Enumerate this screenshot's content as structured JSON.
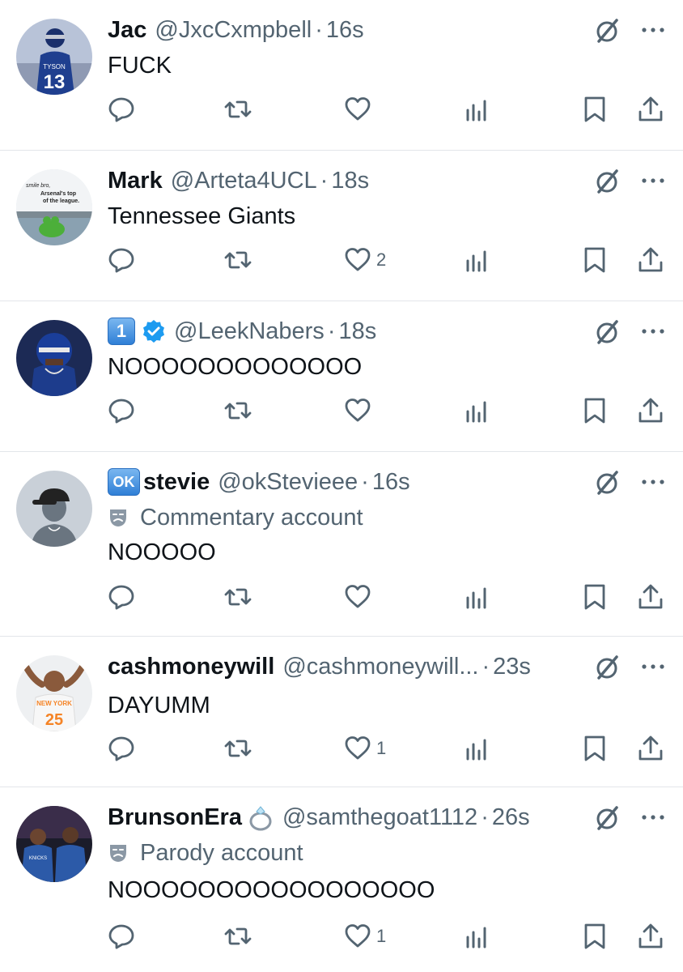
{
  "tweets": [
    {
      "name": "Jac",
      "handle": "@JxcCxmpbell",
      "time": "16s",
      "text": "FUCK",
      "likes": "",
      "avatar": "football-player-tyson-13"
    },
    {
      "name": "Mark",
      "handle": "@Arteta4UCL",
      "time": "18s",
      "text": "Tennessee Giants",
      "likes": "2",
      "avatar": "kermit-meme",
      "avatar_caption": "smile bro, Arsenal's top of the league."
    },
    {
      "name": "",
      "name_emoji": "1",
      "verified": true,
      "handle": "@LeekNabers",
      "time": "18s",
      "text": "NOOOOOOOOOOOOO",
      "likes": "",
      "avatar": "giants-player-helmet"
    },
    {
      "name": "stevie",
      "name_emoji": "OK",
      "handle": "@okStevieee",
      "time": "16s",
      "label": "Commentary account",
      "text": "NOOOOO",
      "likes": "",
      "avatar": "default-profile-cap"
    },
    {
      "name": "cashmoneywill",
      "handle": "@cashmoneywill...",
      "time": "23s",
      "text": "DAYUMM",
      "likes": "1",
      "avatar": "knicks-player-25"
    },
    {
      "name": "BrunsonEra",
      "name_icon": "ring",
      "handle": "@samthegoat1112",
      "time": "26s",
      "label": "Parody account",
      "text": "NOOOOOOOOOOOOOOOOO",
      "likes": "1",
      "avatar": "knicks-players-court"
    }
  ],
  "colors": {
    "text": "#0f1419",
    "secondary": "#536471",
    "verified": "#1d9bf0",
    "divider": "#e3e6ea"
  }
}
